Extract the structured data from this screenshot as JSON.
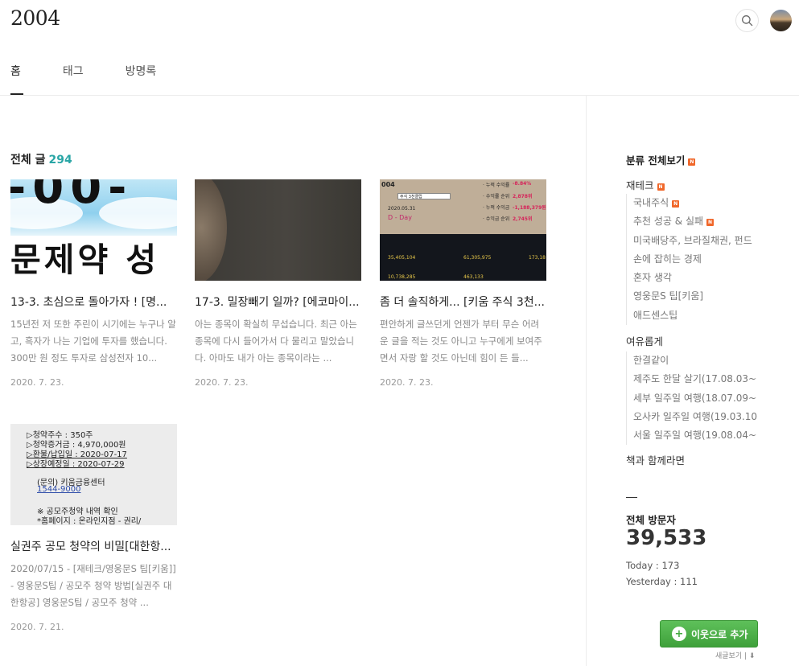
{
  "header": {
    "site_title": "2004",
    "search_icon": "search-icon",
    "avatar": "avatar"
  },
  "tabs": [
    {
      "label": "홈",
      "active": true
    },
    {
      "label": "태그",
      "active": false
    },
    {
      "label": "방명록",
      "active": false
    }
  ],
  "posts_header": {
    "label": "전체 글",
    "count": "294"
  },
  "posts": [
    {
      "title": "13-3. 초심으로 돌아가자 ! [명...",
      "summary": "15년전 저 또한 주린이 시기에는 누구나 알고, 흑자가 나는 기업에 투자를 했습니다. 300만 원 정도 투자로 삼성전자 10...",
      "date": "2020. 7. 23.",
      "thumb": {
        "big_text": "-00-",
        "word": "문제약 성"
      }
    },
    {
      "title": "17-3. 밀장빼기 일까? [에코마이...",
      "summary": "아는 종목이 확실히 무섭습니다. 최근 아는 종목에 다시 들어가서 다 물리고 말았습니다. 아마도 내가 아는 종목이라는 ...",
      "date": "2020. 7. 23.",
      "thumb": {}
    },
    {
      "title": "좀 더 솔직하게... [키움 주식 3천...",
      "summary": "편안하게 글쓰던게 언젠가 부터 무슨 어려운 글을 적는 것도 아니고 누구에게 보여주면서 자랑 할 것도 아닌데 힘이 든 들...",
      "date": "2020. 7. 23.",
      "thumb": {
        "year": "004",
        "label_a": "주식 3천클럽",
        "date": "2020.05.31",
        "dday": "D - Day",
        "rows": [
          {
            "label": "· 누적 수익률",
            "value": "-8.84%"
          },
          {
            "label": "· 수익률 순위",
            "value": "2,878위"
          },
          {
            "label": "· 누적 수익금",
            "value": "-1,188,379원"
          },
          {
            "label": "· 수익금 순위",
            "value": "2,745위"
          }
        ],
        "values_bottom": [
          "35,405,104",
          "61,305,975",
          "173,18",
          "10,738,285",
          "463,133"
        ]
      }
    },
    {
      "title": "실권주 공모 청약의 비밀[대한항...",
      "summary": "2020/07/15 - [재테크/영웅문S 팁[키움]] - 영웅문S팁 / 공모주 청약 방법[실권주 대한항공] 영웅문S팁 / 공모주 청약 ...",
      "date": "2020. 7. 21.",
      "thumb": {
        "lines": [
          "▷청약주수 : 350주",
          "▷청약증거금 : 4,970,000원",
          "▷환불/납입일 : 2020-07-17",
          "▷상장예정일 : 2020-07-29",
          "(문의) 키움금융센터",
          "1544-9000",
          "※ 공모주청약 내역 확인",
          "*홈페이지 : 온라인지점 - 권리/"
        ]
      }
    }
  ],
  "sidebar": {
    "category_all": "분류 전체보기",
    "new_badge": "N",
    "groups": [
      {
        "name": "재테크",
        "new": true,
        "items": [
          {
            "label": "국내주식",
            "new": true
          },
          {
            "label": "추천 성공 & 실패",
            "new": true
          },
          {
            "label": "미국배당주, 브라질채권, 펀드",
            "new": false
          },
          {
            "label": "손에 잡히는 경제",
            "new": false
          },
          {
            "label": "혼자 생각",
            "new": false
          },
          {
            "label": "영웅문S 팁[키움]",
            "new": false
          },
          {
            "label": "애드센스팁",
            "new": false
          }
        ]
      },
      {
        "name": "여유롭게",
        "new": false,
        "items": [
          {
            "label": "한결같이",
            "new": false
          },
          {
            "label": "제주도 한달 살기(17.08.03~0..",
            "new": false
          },
          {
            "label": "세부 일주일 여행(18.07.09~0..",
            "new": false
          },
          {
            "label": "오사카 일주일 여행(19.03.10..",
            "new": false
          },
          {
            "label": "서울 일주일 여행(19.08.04~0..",
            "new": false
          }
        ]
      },
      {
        "name": "책과 함께라면",
        "new": false,
        "items": []
      }
    ],
    "visitors": {
      "label": "전체 방문자",
      "total": "39,533",
      "today": "Today : 173",
      "yesterday": "Yesterday : 111"
    }
  },
  "neighbor_button": {
    "label": "이웃으로 추가"
  },
  "subscribe": {
    "label": "새글보기 | ⬇"
  },
  "colors": {
    "accent": "#2aa6a6",
    "badge": "#f0672a",
    "button": "#4cae48"
  }
}
